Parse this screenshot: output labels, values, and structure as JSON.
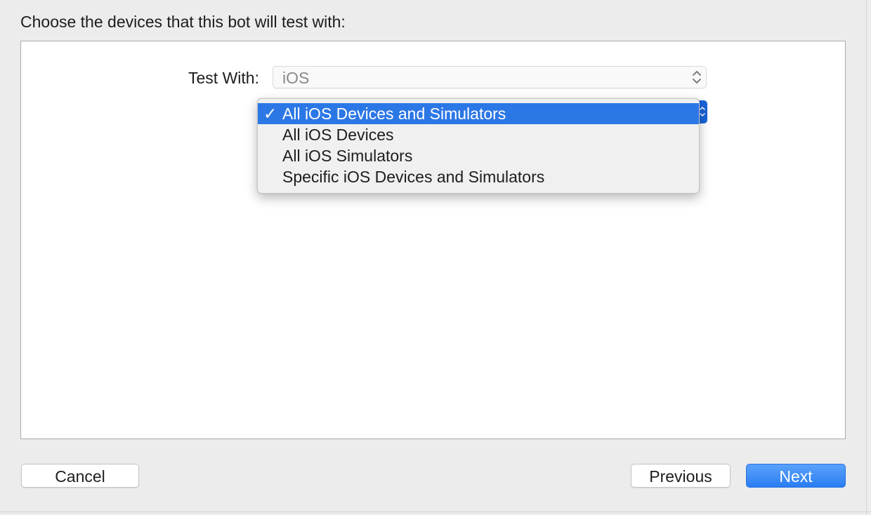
{
  "dialog": {
    "heading": "Choose the devices that this bot will test with:"
  },
  "test_with": {
    "label": "Test With:",
    "value": "iOS",
    "arrows_icon": "up-down-chevrons-icon"
  },
  "device_menu": {
    "check_mark": "✓",
    "items": [
      {
        "label": "All iOS Devices and Simulators",
        "selected": true
      },
      {
        "label": "All iOS Devices",
        "selected": false
      },
      {
        "label": "All iOS Simulators",
        "selected": false
      },
      {
        "label": "Specific iOS Devices and Simulators",
        "selected": false
      }
    ]
  },
  "buttons": {
    "cancel": "Cancel",
    "previous": "Previous",
    "next": "Next"
  },
  "colors": {
    "accent": "#2c77e6",
    "window_background": "#ececec",
    "panel_background": "#ffffff"
  }
}
